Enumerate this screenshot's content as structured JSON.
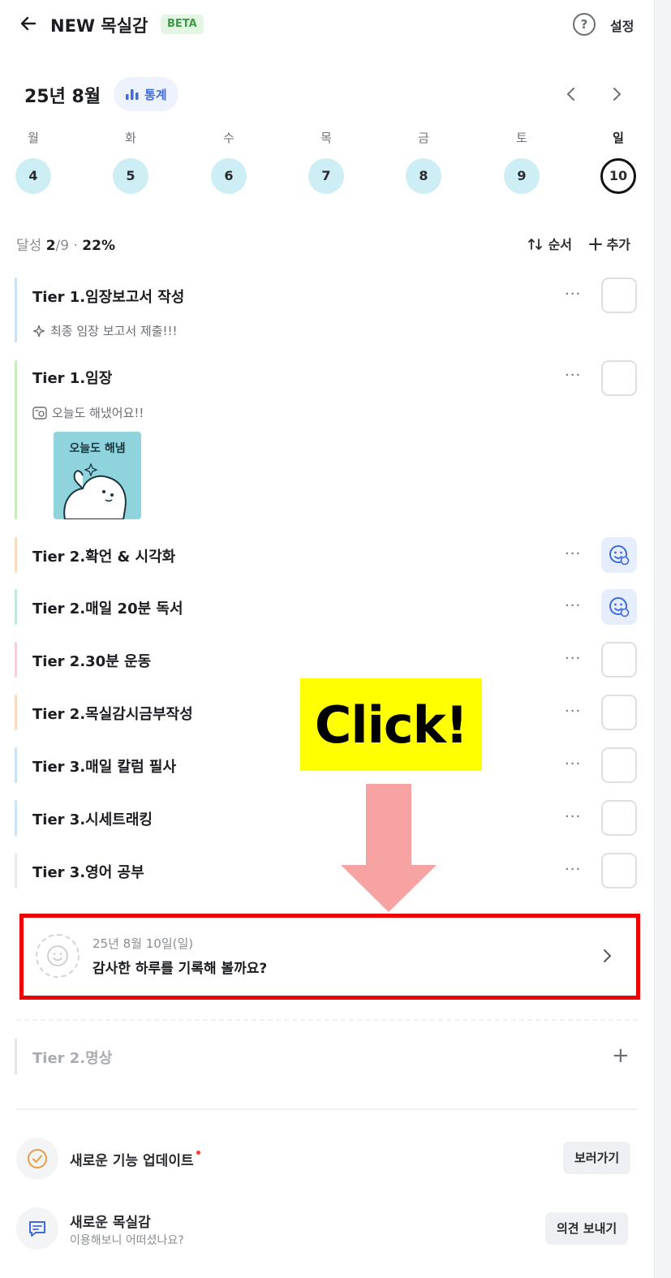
{
  "header": {
    "title": "NEW 목실감",
    "badge": "BETA",
    "help_glyph": "?",
    "settings_label": "설정"
  },
  "calendar": {
    "month_label": "25년 8월",
    "stats_label": "통계",
    "days": [
      {
        "label": "월",
        "num": "4"
      },
      {
        "label": "화",
        "num": "5"
      },
      {
        "label": "수",
        "num": "6"
      },
      {
        "label": "목",
        "num": "7"
      },
      {
        "label": "금",
        "num": "8"
      },
      {
        "label": "토",
        "num": "9"
      },
      {
        "label": "일",
        "num": "10"
      }
    ]
  },
  "summary": {
    "prefix": "달성 ",
    "done": "2",
    "total": "/9",
    "sep": " · ",
    "percent": "22%",
    "order_label": "순서",
    "add_label": "추가"
  },
  "habits": [
    {
      "name": "Tier 1.임장보고서 작성",
      "note": "최종 임장 보고서 제출!!!",
      "color": "#c9e3f6",
      "checked": false
    },
    {
      "name": "Tier 1.임장",
      "note": "오늘도 해냈어요!!",
      "sticker_text": "오늘도 해냄",
      "color": "#c8ecb8",
      "checked": false
    },
    {
      "name": "Tier 2.확언 & 시각화",
      "color": "#f8dcc0",
      "checked": true
    },
    {
      "name": "Tier 2.매일 20분 독서",
      "color": "#bfe8e0",
      "checked": true
    },
    {
      "name": "Tier 2.30분 운동",
      "color": "#f6cfdc",
      "checked": false
    },
    {
      "name": "Tier 2.목실감시금부작성",
      "color": "#f8dcc0",
      "checked": false
    },
    {
      "name": "Tier 3.매일 칼럼 필사",
      "color": "#c9e3f6",
      "checked": false
    },
    {
      "name": "Tier 3.시세트래킹",
      "color": "#c9e3f6",
      "checked": false
    },
    {
      "name": "Tier 3.영어 공부",
      "color": "#e8eaed",
      "checked": false
    }
  ],
  "annotation": {
    "click_text": "Click!",
    "box_color": "#ee0000",
    "highlight_color": "#ffff00",
    "arrow_color": "#f7a3a3"
  },
  "gratitude": {
    "date": "25년 8월 10일(일)",
    "prompt": "감사한 하루를 기록해 볼까요?"
  },
  "inactive_habit": {
    "name": "Tier 2.명상"
  },
  "features": [
    {
      "title": "새로운 기능 업데이트",
      "button": "보러가기",
      "icon": "check-circle-icon"
    },
    {
      "title": "새로운 목실감",
      "subtitle": "이용해보니 어떠셨나요?",
      "button": "의견 보내기",
      "icon": "message-icon"
    }
  ]
}
